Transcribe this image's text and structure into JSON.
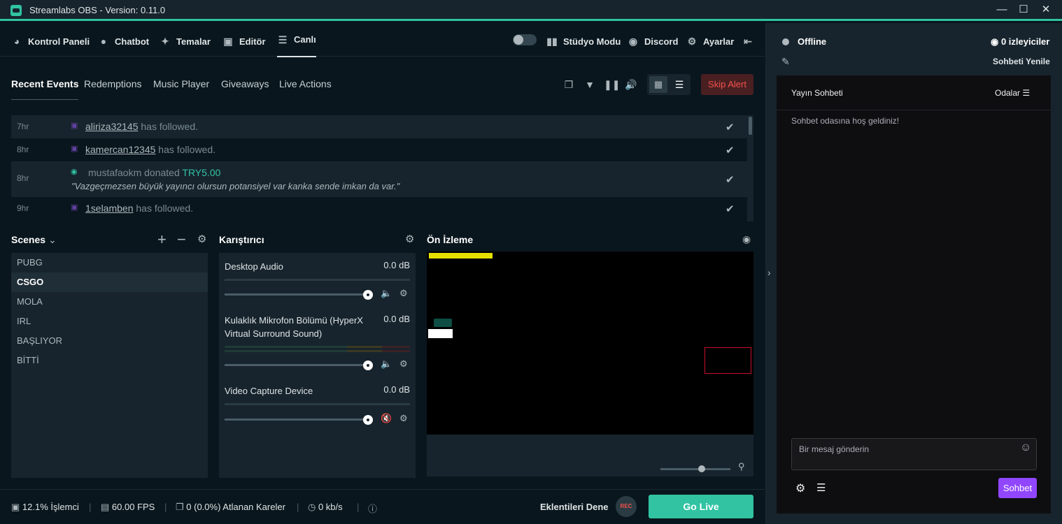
{
  "window": {
    "title": "Streamlabs OBS - Version: 0.11.0"
  },
  "nav": {
    "items": [
      {
        "label": "Kontrol Paneli",
        "icon": "dashboard-icon"
      },
      {
        "label": "Chatbot",
        "icon": "chat-bubble-icon"
      },
      {
        "label": "Temalar",
        "icon": "magic-wand-icon"
      },
      {
        "label": "Editör",
        "icon": "studio-icon"
      },
      {
        "label": "Canlı",
        "icon": "list-icon"
      }
    ],
    "right": [
      {
        "label": "Stüdyo Modu",
        "icon": "studio-mode-icon"
      },
      {
        "label": "Discord",
        "icon": "discord-icon"
      },
      {
        "label": "Ayarlar",
        "icon": "gear-icon"
      }
    ]
  },
  "events_tabs": [
    "Recent Events",
    "Redemptions",
    "Music Player",
    "Giveaways",
    "Live Actions"
  ],
  "skip_alert": "Skip Alert",
  "events": [
    {
      "time": "7hr",
      "user": "aliriza32145",
      "text": " has followed."
    },
    {
      "time": "8hr",
      "user": "kamercan12345",
      "text": " has followed."
    },
    {
      "time": "8hr",
      "user": "mustafaokm",
      "text": " donated ",
      "amount": "TRY5.00",
      "note": "\"Vazgeçmezsen büyük yayıncı olursun potansiyel var kanka sende imkan da var.\""
    },
    {
      "time": "9hr",
      "user": "1selamben",
      "text": " has followed."
    }
  ],
  "scenes": {
    "title": "Scenes",
    "items": [
      "PUBG",
      "CSGO",
      "MOLA",
      "IRL",
      "BAŞLIYOR",
      "BİTTİ"
    ],
    "selected": 1
  },
  "mixer": {
    "title": "Karıştırıcı",
    "sources": [
      {
        "name": "Desktop Audio",
        "db": "0.0 dB",
        "volume": 1.0
      },
      {
        "name": "Kulaklık Mikrofon Bölümü (HyperX Virtual Surround Sound)",
        "db": "0.0 dB",
        "volume": 1.0
      },
      {
        "name": "Video Capture Device",
        "db": "0.0 dB",
        "volume": 1.0
      }
    ]
  },
  "preview": {
    "title": "Ön İzleme"
  },
  "status": {
    "cpu": "12.1% İşlemci",
    "fps": "60.00 FPS",
    "dropped": "0 (0.0%) Atlanan Kareler",
    "bandwidth": "0 kb/s",
    "try_plugins": "Eklentileri Dene",
    "rec": "REC",
    "go_live": "Go Live"
  },
  "chat": {
    "status": "Offline",
    "viewers": "0 izleyiciler",
    "refresh": "Sohbeti Yenile",
    "header": "Yayın Sohbeti",
    "rooms": "Odalar",
    "welcome": "Sohbet odasına hoş geldiniz!",
    "placeholder": "Bir mesaj gönderin",
    "send": "Sohbet"
  },
  "colors": {
    "accent": "#31c3a2",
    "background": "#09161d",
    "panel": "#17242d",
    "twitch": "#9147ff",
    "danger": "#f2524b"
  }
}
